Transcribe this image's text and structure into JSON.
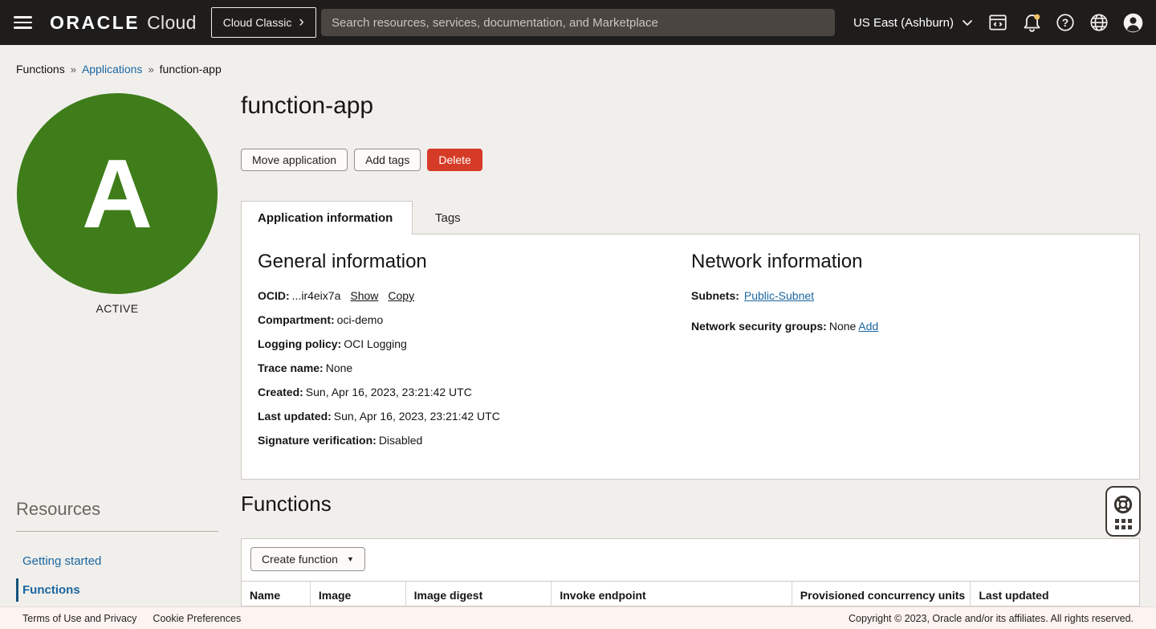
{
  "topbar": {
    "brand_oracle": "ORACLE",
    "brand_cloud": "Cloud",
    "cloud_classic_label": "Cloud Classic",
    "search_placeholder": "Search resources, services, documentation, and Marketplace",
    "region_label": "US East (Ashburn)",
    "icons": [
      "menu-icon",
      "code-console-icon",
      "notifications-bell-icon",
      "help-icon",
      "language-globe-icon",
      "user-avatar-icon"
    ]
  },
  "breadcrumb": {
    "items": [
      "Functions",
      "Applications",
      "function-app"
    ]
  },
  "app": {
    "title": "function-app",
    "avatar_letter": "A",
    "status": "ACTIVE"
  },
  "actions": {
    "move_label": "Move application",
    "add_tags_label": "Add tags",
    "delete_label": "Delete"
  },
  "tabs": [
    {
      "label": "Application information",
      "active": true
    },
    {
      "label": "Tags",
      "active": false
    }
  ],
  "general_info": {
    "heading": "General information",
    "rows": [
      {
        "label": "OCID:",
        "value": "...ir4eix7a",
        "links": [
          "Show",
          "Copy"
        ]
      },
      {
        "label": "Compartment:",
        "value": "oci-demo"
      },
      {
        "label": "Logging policy:",
        "value": "OCI Logging"
      },
      {
        "label": "Trace name:",
        "value": "None"
      },
      {
        "label": "Created:",
        "value": "Sun, Apr 16, 2023, 23:21:42 UTC"
      },
      {
        "label": "Last updated:",
        "value": "Sun, Apr 16, 2023, 23:21:42 UTC"
      },
      {
        "label": "Signature verification:",
        "value": "Disabled"
      }
    ]
  },
  "network_info": {
    "heading": "Network information",
    "rows": [
      {
        "label": "Subnets:",
        "link": "Public-Subnet"
      },
      {
        "label": "Network security groups:",
        "value": "None",
        "link": "Add"
      }
    ]
  },
  "sidebar": {
    "heading": "Resources",
    "items": [
      {
        "label": "Getting started",
        "active": false
      },
      {
        "label": "Functions",
        "active": true
      }
    ]
  },
  "functions_section": {
    "heading": "Functions",
    "create_button_label": "Create function",
    "table_headers": [
      "Name",
      "Image",
      "Image digest",
      "Invoke endpoint",
      "Provisioned concurrency units",
      "Last updated"
    ]
  },
  "footer": {
    "links": [
      "Terms of Use and Privacy",
      "Cookie Preferences"
    ],
    "copyright": "Copyright © 2023, Oracle and/or its affiliates. All rights reserved."
  },
  "colors": {
    "topbar_bg": "#1f1d1c",
    "search_bg": "#4a4541",
    "page_bg": "#f1efec",
    "panel_border": "#cfc9c3",
    "accent_link": "#1b66a0",
    "danger_red": "#d63b27",
    "status_green": "#3e7d1a",
    "badge_yellow": "#ecc263",
    "footer_bg": "#fdf4f2",
    "text_primary": "#161513"
  }
}
